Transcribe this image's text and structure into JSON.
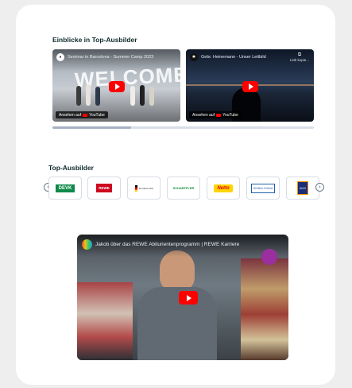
{
  "insights": {
    "title": "Einblicke in Top-Ausbilder",
    "videos": [
      {
        "title": "Seminar in Barcelona - Summer Camp 2023",
        "watch_label": "Ansehen auf",
        "platform": "YouTube",
        "sign_text": "WELCOME"
      },
      {
        "title": "Gebr. Heinemann - Unser Leitbild",
        "watch_label": "Ansehen auf",
        "platform": "YouTube",
        "side_label": "Link kopie..."
      }
    ],
    "progress": 0.3
  },
  "top_trainers": {
    "title": "Top-Ausbilder",
    "prev_icon": "chevron-left-icon",
    "next_icon": "chevron-right-icon",
    "logos": [
      "DEVK",
      "REWE",
      "Bundesministerium",
      "SCHAEFFLER",
      "Netto",
      "SIGNAL IDUNA",
      "ALDI"
    ]
  },
  "feature_video": {
    "title": "Jakob über das REWE Abiturientenprogramm | REWE Karriere",
    "platform": "YouTube"
  },
  "colors": {
    "accent": "#0f2a2a",
    "progress": "#d9dee8",
    "progress_fill": "#a7b2c6",
    "yt_red": "#ff0000"
  }
}
